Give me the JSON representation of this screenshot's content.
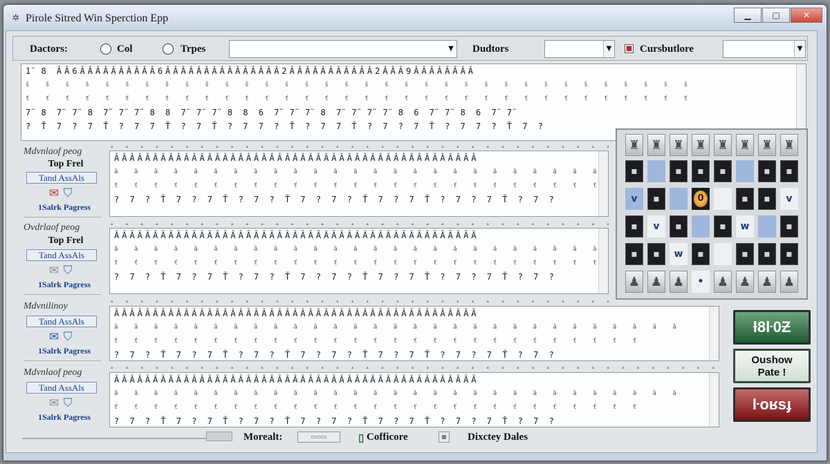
{
  "window": {
    "title": "Pirole Sitred Win Sperction Epp"
  },
  "toolbar": {
    "label1": "Dactors:",
    "radio1": "Col",
    "radio2": "Trpes",
    "label2": "Dudtors",
    "check_label": "Cursbutlore"
  },
  "grids": {
    "top_rows": [
      "1̈ 8 ÂÂ6ÂÂÂÂÂÂÂÂÂÂ6ÂÂÂÂÂÂÂÂÂÂÂÂÂÂÂ2ÂÂÂÂÂÂÂÂÂÂÂ2ÂÂÂ9ÂÂÂÂÂÂÂÂ",
      "ŝ ŝ ŝ ŝ ŝ ŝ ŝ ŝ ŝ ŝ ŝ ŝ ŝ ŝ ŝ ŝ ŝ ŝ ŝ ŝ ŝ ŝ ŝ ŝ ŝ ŝ ŝ ŝ ŝ ŝ ŝ ŝ ŝ ŝ",
      "ť ť ť ť ť ť ť ť ť ť ť ť ť ť ť ť ť ť ť ť ť ť ť ť ť ť ť ť ť ť ť ť ť ť",
      "7̈ 8 7̈ 7̈ 8 7̈ 7̈ 7̈ 8 8 7̈ 7̈ 7̈ 8 8 6 7̈ 7̈ 7̈ 8 7̈ 7̈ 7̈ 7̈ 8 6 7̈ 7̈ 8 6 7̈ 7̈",
      "? Ť 7 ? 7 Ť ? 7 7 Ť ? 7 Ť ? 7 7 ? Ť ? 7 7 Ť ? 7 ? 7 Ť ? 7 7 ? Ť 7 ?"
    ],
    "mid_rows": [
      "ÂÂÂÂÂÂÂÂÂÂÂÂÂÂÂÂÂÂÂÂÂÂÂÂÂÂÂÂÂÂÂÂÂÂÂÂÂÂÂÂÂÂÂÂÂÂÂ",
      "ȁ ȁ ȁ ȁ ȁ ȁ ȁ ȁ ȁ ȁ ȁ ȁ ȁ ȁ ȁ ȁ ȁ ȁ ȁ ȁ ȁ ȁ ȁ ȁ ȁ ȁ ȁ ȁ ȁ",
      "ť ť ť ť ť ť ť ť ť ť ť ť ť ť ť ť ť ť ť ť ť ť ť ť ť ť ť",
      "? 7 ? Ť 7 ? 7 Ť ? 7 ? Ť 7 ? 7 ? Ť 7 ? 7 Ť ? 7 ? 7 Ť ? 7 ?"
    ]
  },
  "left_panel": {
    "sections": [
      {
        "title": "Mdvnlaof peog",
        "subtitle": "Top Frel",
        "button": "Tand AssAls",
        "progress": "1Salrk Pagress"
      },
      {
        "title": "Ovdrlaof peog",
        "subtitle": "Top Frel",
        "button": "Tand AssAls",
        "progress": "1Salrk Pagress"
      },
      {
        "title": "Mdvnilinoy",
        "subtitle": "",
        "button": "Tand AssAls",
        "progress": "1Salrk Pagress"
      },
      {
        "title": "Mdvnlaof peog",
        "subtitle": "",
        "button": "Tand AssAls",
        "progress": "1Salrk Pagress"
      }
    ]
  },
  "board": {
    "pieces_top": "♜",
    "pieces_bottom": "♟",
    "marker": "0",
    "blue_mark": "v",
    "w_mark": "w"
  },
  "actions": {
    "green_label": "ƚ8ŀ0Ƶ",
    "grey_label_1": "Oushow",
    "grey_label_2": "Pate !",
    "red_label": "ŀoʁsɟ"
  },
  "status": {
    "label1": "Morealt:",
    "label2": "Cofficore",
    "label3": "Dixctey Dales"
  }
}
